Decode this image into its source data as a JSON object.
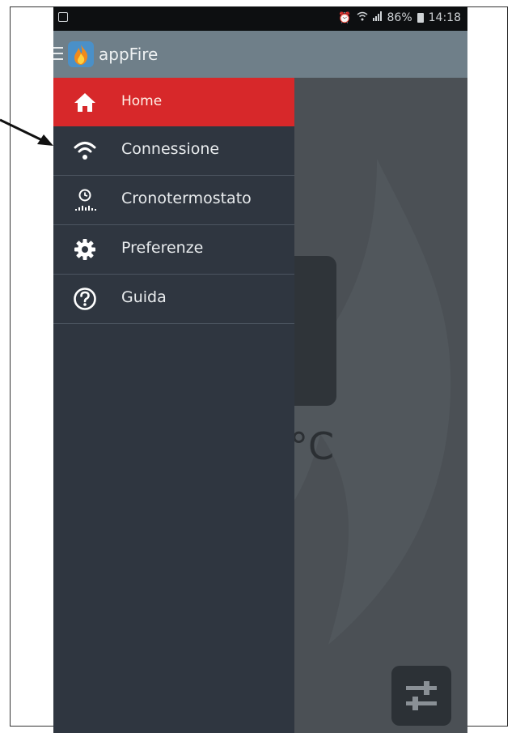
{
  "status_bar": {
    "battery": "86%",
    "time": "14:18"
  },
  "app_bar": {
    "title": "appFire"
  },
  "drawer": {
    "items": [
      {
        "label": "Home",
        "icon": "home-icon",
        "active": true
      },
      {
        "label": "Connessione",
        "icon": "wifi-icon",
        "active": false
      },
      {
        "label": "Cronotermostato",
        "icon": "clock-schedule-icon",
        "active": false
      },
      {
        "label": "Preferenze",
        "icon": "gear-icon",
        "active": false
      },
      {
        "label": "Guida",
        "icon": "help-icon",
        "active": false
      }
    ]
  },
  "main": {
    "temp_unit": "°C"
  },
  "colors": {
    "active_item": "#d7282a",
    "drawer_bg": "#2f3640",
    "app_bar": "#6f7f89"
  }
}
